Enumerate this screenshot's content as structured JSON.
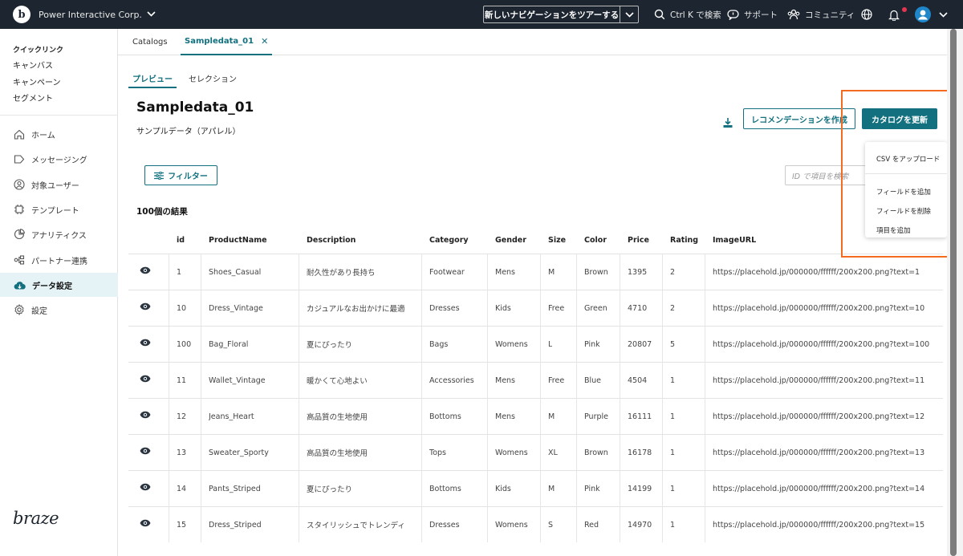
{
  "topbar": {
    "org_name": "Power Interactive Corp.",
    "tour_label": "新しいナビゲーションをツアーする",
    "search_label": "Ctrl K で検索",
    "support_label": "サポート",
    "community_label": "コミュニティ"
  },
  "sidebar": {
    "quicklinks_title": "クイックリンク",
    "quicklinks": [
      "キャンバス",
      "キャンペーン",
      "セグメント"
    ],
    "items": [
      {
        "label": "ホーム",
        "icon": "home-icon"
      },
      {
        "label": "メッセージング",
        "icon": "messaging-icon"
      },
      {
        "label": "対象ユーザー",
        "icon": "audience-icon"
      },
      {
        "label": "テンプレート",
        "icon": "template-icon"
      },
      {
        "label": "アナリティクス",
        "icon": "analytics-icon"
      },
      {
        "label": "パートナー連携",
        "icon": "partner-icon"
      },
      {
        "label": "データ設定",
        "icon": "cloud-icon",
        "active": true
      },
      {
        "label": "設定",
        "icon": "settings-icon"
      }
    ],
    "brand": "braze"
  },
  "tabs": {
    "catalogs": "Catalogs",
    "sampledata": "Sampledata_01"
  },
  "subtabs": {
    "preview": "プレビュー",
    "selection": "セレクション"
  },
  "page": {
    "title": "Sampledata_01",
    "subtitle": "サンプルデータ（アパレル）",
    "create_reco_button": "レコメンデーションを作成",
    "update_catalog_button": "カタログを更新",
    "filter_button": "フィルター",
    "search_placeholder": "ID で項目を検索",
    "results_count": "100個の結果"
  },
  "dropdown": {
    "upload_csv": "CSV をアップロード",
    "add_field": "フィールドを追加",
    "delete_field": "フィールドを削除",
    "add_item": "項目を追加"
  },
  "table": {
    "columns": [
      "id",
      "ProductName",
      "Description",
      "Category",
      "Gender",
      "Size",
      "Color",
      "Price",
      "Rating",
      "ImageURL"
    ],
    "rows": [
      [
        "1",
        "Shoes_Casual",
        "耐久性があり長持ち",
        "Footwear",
        "Mens",
        "M",
        "Brown",
        "1395",
        "2",
        "https://placehold.jp/000000/ffffff/200x200.png?text=1"
      ],
      [
        "10",
        "Dress_Vintage",
        "カジュアルなお出かけに最適",
        "Dresses",
        "Kids",
        "Free",
        "Green",
        "4710",
        "2",
        "https://placehold.jp/000000/ffffff/200x200.png?text=10"
      ],
      [
        "100",
        "Bag_Floral",
        "夏にぴったり",
        "Bags",
        "Womens",
        "L",
        "Pink",
        "20807",
        "5",
        "https://placehold.jp/000000/ffffff/200x200.png?text=100"
      ],
      [
        "11",
        "Wallet_Vintage",
        "暖かくて心地よい",
        "Accessories",
        "Mens",
        "Free",
        "Blue",
        "4504",
        "1",
        "https://placehold.jp/000000/ffffff/200x200.png?text=11"
      ],
      [
        "12",
        "Jeans_Heart",
        "高品質の生地使用",
        "Bottoms",
        "Mens",
        "M",
        "Purple",
        "16111",
        "1",
        "https://placehold.jp/000000/ffffff/200x200.png?text=12"
      ],
      [
        "13",
        "Sweater_Sporty",
        "高品質の生地使用",
        "Tops",
        "Womens",
        "XL",
        "Brown",
        "16178",
        "1",
        "https://placehold.jp/000000/ffffff/200x200.png?text=13"
      ],
      [
        "14",
        "Pants_Striped",
        "夏にぴったり",
        "Bottoms",
        "Kids",
        "M",
        "Pink",
        "14199",
        "1",
        "https://placehold.jp/000000/ffffff/200x200.png?text=14"
      ],
      [
        "15",
        "Dress_Striped",
        "スタイリッシュでトレンディ",
        "Dresses",
        "Womens",
        "S",
        "Red",
        "14970",
        "1",
        "https://placehold.jp/000000/ffffff/200x200.png?text=15"
      ]
    ]
  },
  "colors": {
    "accent": "#12707f",
    "topbar": "#1d2630",
    "highlight": "#f26b21"
  }
}
